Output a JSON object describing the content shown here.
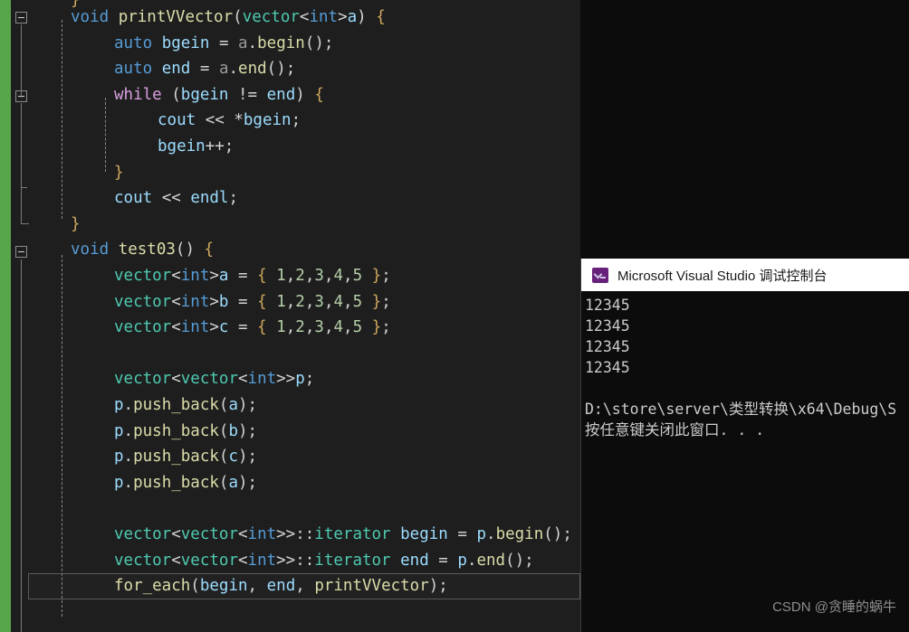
{
  "editor": {
    "name": "visual-studio-code-editor",
    "background": "#1e1e1e",
    "change_bar_color": "#57a64a",
    "current_line": "for_each(begin, end, printVVector);",
    "lines": [
      {
        "indent": 0,
        "text": "}"
      },
      {
        "indent": 0,
        "text": "void printVVector(vector<int>a) {"
      },
      {
        "indent": 1,
        "text": "auto bgein = a.begin();"
      },
      {
        "indent": 1,
        "text": "auto end = a.end();"
      },
      {
        "indent": 1,
        "text": "while (bgein != end) {"
      },
      {
        "indent": 2,
        "text": "cout << *bgein;"
      },
      {
        "indent": 2,
        "text": "bgein++;"
      },
      {
        "indent": 1,
        "text": "}"
      },
      {
        "indent": 1,
        "text": "cout << endl;"
      },
      {
        "indent": 0,
        "text": "}"
      },
      {
        "indent": 0,
        "text": "void test03() {"
      },
      {
        "indent": 1,
        "text": "vector<int>a = { 1,2,3,4,5 };"
      },
      {
        "indent": 1,
        "text": "vector<int>b = { 1,2,3,4,5 };"
      },
      {
        "indent": 1,
        "text": "vector<int>c = { 1,2,3,4,5 };"
      },
      {
        "indent": 1,
        "text": ""
      },
      {
        "indent": 1,
        "text": "vector<vector<int>>p;"
      },
      {
        "indent": 1,
        "text": "p.push_back(a);"
      },
      {
        "indent": 1,
        "text": "p.push_back(b);"
      },
      {
        "indent": 1,
        "text": "p.push_back(c);"
      },
      {
        "indent": 1,
        "text": "p.push_back(a);"
      },
      {
        "indent": 1,
        "text": ""
      },
      {
        "indent": 1,
        "text": "vector<vector<int>>::iterator begin = p.begin();"
      },
      {
        "indent": 1,
        "text": "vector<vector<int>>::iterator end = p.end();"
      },
      {
        "indent": 1,
        "text": "for_each(begin, end, printVVector);"
      },
      {
        "indent": 1,
        "text": ""
      }
    ],
    "token_colors": {
      "keyword": "#569cd6",
      "control_keyword": "#d8a0df",
      "function": "#dcdcaa",
      "type": "#4ec9b0",
      "variable": "#9cdcfe",
      "number": "#b5cea8",
      "punctuation": "#d4d4d4"
    }
  },
  "console": {
    "title": "Microsoft Visual Studio 调试控制台",
    "icon": "console-icon",
    "output": [
      "12345",
      "12345",
      "12345",
      "12345",
      "",
      "D:\\store\\server\\类型转换\\x64\\Debug\\S",
      "按任意键关闭此窗口. . ."
    ],
    "background": "#0c0c0c",
    "text_color": "#cccccc",
    "titlebar_background": "#ffffff"
  },
  "watermark": {
    "text": "CSDN @贪睡的蜗牛"
  }
}
